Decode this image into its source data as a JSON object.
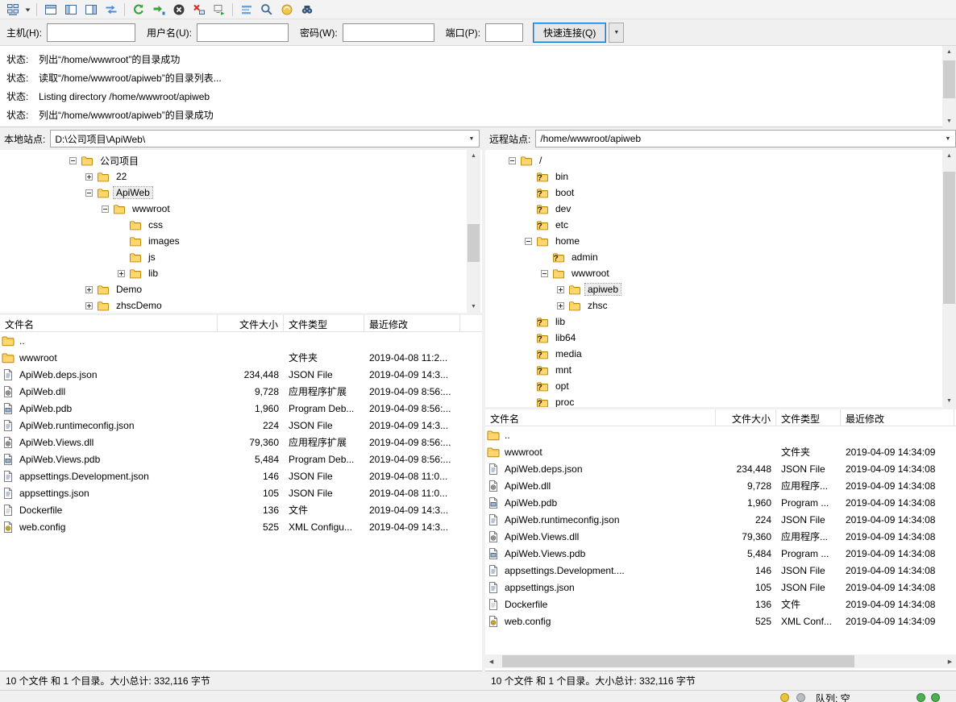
{
  "toolbar": {
    "items": [
      {
        "icon": "site-manager-icon"
      },
      {
        "icon": "site-manager-caret-icon",
        "narrow": true
      },
      {
        "separator": true
      },
      {
        "icon": "message-log-toggle-icon"
      },
      {
        "icon": "local-tree-toggle-icon"
      },
      {
        "icon": "remote-tree-toggle-icon"
      },
      {
        "icon": "queue-toggle-icon"
      },
      {
        "separator": true
      },
      {
        "icon": "refresh-icon"
      },
      {
        "icon": "process-queue-icon"
      },
      {
        "icon": "cancel-icon"
      },
      {
        "icon": "disconnect-icon"
      },
      {
        "icon": "reconnect-icon"
      },
      {
        "separator": true
      },
      {
        "icon": "filter-icon"
      },
      {
        "icon": "compare-icon"
      },
      {
        "icon": "sync-browse-icon"
      },
      {
        "icon": "find-icon"
      }
    ]
  },
  "quickconnect": {
    "host_label": "主机(H):",
    "host_value": "",
    "username_label": "用户名(U):",
    "username_value": "",
    "password_label": "密码(W):",
    "password_value": "",
    "port_label": "端口(P):",
    "port_value": "",
    "connect_label": "快速连接(Q)"
  },
  "log": {
    "lines": [
      {
        "prefix": "状态:",
        "text": "列出“/home/wwwroot”的目录成功"
      },
      {
        "prefix": "状态:",
        "text": "读取“/home/wwwroot/apiweb”的目录列表..."
      },
      {
        "prefix": "状态:",
        "text": "Listing directory /home/wwwroot/apiweb"
      },
      {
        "prefix": "状态:",
        "text": "列出“/home/wwwroot/apiweb”的目录成功"
      }
    ]
  },
  "local": {
    "site_label": "本地站点:",
    "site_path": "D:\\公司项目\\ApiWeb\\",
    "tree": [
      {
        "label": "公司项目",
        "level": 0,
        "expander": "minus",
        "icon": "folder"
      },
      {
        "label": "22",
        "level": 1,
        "expander": "plus",
        "icon": "folder"
      },
      {
        "label": "ApiWeb",
        "level": 1,
        "expander": "minus",
        "icon": "folder",
        "selected": true
      },
      {
        "label": "wwwroot",
        "level": 2,
        "expander": "minus",
        "icon": "folder"
      },
      {
        "label": "css",
        "level": 3,
        "expander": "none",
        "icon": "folder"
      },
      {
        "label": "images",
        "level": 3,
        "expander": "none",
        "icon": "folder"
      },
      {
        "label": "js",
        "level": 3,
        "expander": "none",
        "icon": "folder"
      },
      {
        "label": "lib",
        "level": 3,
        "expander": "plus",
        "icon": "folder"
      },
      {
        "label": "Demo",
        "level": 1,
        "expander": "plus",
        "icon": "folder"
      },
      {
        "label": "zhscDemo",
        "level": 1,
        "expander": "plus",
        "icon": "folder"
      }
    ],
    "columns": [
      {
        "label": "文件名"
      },
      {
        "label": "文件大小"
      },
      {
        "label": "文件类型"
      },
      {
        "label": "最近修改"
      }
    ],
    "files": [
      {
        "icon": "folder",
        "name": "..",
        "size": "",
        "type": "",
        "modified": ""
      },
      {
        "icon": "folder",
        "name": "wwwroot",
        "size": "",
        "type": "文件夹",
        "modified": "2019-04-08 11:2..."
      },
      {
        "icon": "file-json",
        "name": "ApiWeb.deps.json",
        "size": "234,448",
        "type": "JSON File",
        "modified": "2019-04-09 14:3..."
      },
      {
        "icon": "file-dll",
        "name": "ApiWeb.dll",
        "size": "9,728",
        "type": "应用程序扩展",
        "modified": "2019-04-09 8:56:..."
      },
      {
        "icon": "file-pdb",
        "name": "ApiWeb.pdb",
        "size": "1,960",
        "type": "Program Deb...",
        "modified": "2019-04-09 8:56:..."
      },
      {
        "icon": "file-json",
        "name": "ApiWeb.runtimeconfig.json",
        "size": "224",
        "type": "JSON File",
        "modified": "2019-04-09 14:3..."
      },
      {
        "icon": "file-dll",
        "name": "ApiWeb.Views.dll",
        "size": "79,360",
        "type": "应用程序扩展",
        "modified": "2019-04-09 8:56:..."
      },
      {
        "icon": "file-pdb",
        "name": "ApiWeb.Views.pdb",
        "size": "5,484",
        "type": "Program Deb...",
        "modified": "2019-04-09 8:56:..."
      },
      {
        "icon": "file-json",
        "name": "appsettings.Development.json",
        "size": "146",
        "type": "JSON File",
        "modified": "2019-04-08 11:0..."
      },
      {
        "icon": "file-json",
        "name": "appsettings.json",
        "size": "105",
        "type": "JSON File",
        "modified": "2019-04-08 11:0..."
      },
      {
        "icon": "file-generic",
        "name": "Dockerfile",
        "size": "136",
        "type": "文件",
        "modified": "2019-04-09 14:3..."
      },
      {
        "icon": "file-config",
        "name": "web.config",
        "size": "525",
        "type": "XML Configu...",
        "modified": "2019-04-09 14:3..."
      }
    ],
    "status": "10 个文件 和 1 个目录。大小总计: 332,116 字节"
  },
  "remote": {
    "site_label": "远程站点:",
    "site_path": "/home/wwwroot/apiweb",
    "tree": [
      {
        "label": "/",
        "level": 0,
        "expander": "minus",
        "icon": "folder"
      },
      {
        "label": "bin",
        "level": 1,
        "expander": "none",
        "icon": "folder-question"
      },
      {
        "label": "boot",
        "level": 1,
        "expander": "none",
        "icon": "folder-question"
      },
      {
        "label": "dev",
        "level": 1,
        "expander": "none",
        "icon": "folder-question"
      },
      {
        "label": "etc",
        "level": 1,
        "expander": "none",
        "icon": "folder-question"
      },
      {
        "label": "home",
        "level": 1,
        "expander": "minus",
        "icon": "folder"
      },
      {
        "label": "admin",
        "level": 2,
        "expander": "none",
        "icon": "folder-question"
      },
      {
        "label": "wwwroot",
        "level": 2,
        "expander": "minus",
        "icon": "folder"
      },
      {
        "label": "apiweb",
        "level": 3,
        "expander": "plus",
        "icon": "folder",
        "selected": true
      },
      {
        "label": "zhsc",
        "level": 3,
        "expander": "plus",
        "icon": "folder"
      },
      {
        "label": "lib",
        "level": 1,
        "expander": "none",
        "icon": "folder-question"
      },
      {
        "label": "lib64",
        "level": 1,
        "expander": "none",
        "icon": "folder-question"
      },
      {
        "label": "media",
        "level": 1,
        "expander": "none",
        "icon": "folder-question"
      },
      {
        "label": "mnt",
        "level": 1,
        "expander": "none",
        "icon": "folder-question"
      },
      {
        "label": "opt",
        "level": 1,
        "expander": "none",
        "icon": "folder-question"
      },
      {
        "label": "proc",
        "level": 1,
        "expander": "none",
        "icon": "folder-question"
      }
    ],
    "columns": [
      {
        "label": "文件名"
      },
      {
        "label": "文件大小"
      },
      {
        "label": "文件类型"
      },
      {
        "label": "最近修改"
      }
    ],
    "files": [
      {
        "icon": "folder",
        "name": "..",
        "size": "",
        "type": "",
        "modified": ""
      },
      {
        "icon": "folder",
        "name": "wwwroot",
        "size": "",
        "type": "文件夹",
        "modified": "2019-04-09 14:34:09"
      },
      {
        "icon": "file-json",
        "name": "ApiWeb.deps.json",
        "size": "234,448",
        "type": "JSON File",
        "modified": "2019-04-09 14:34:08"
      },
      {
        "icon": "file-dll",
        "name": "ApiWeb.dll",
        "size": "9,728",
        "type": "应用程序...",
        "modified": "2019-04-09 14:34:08"
      },
      {
        "icon": "file-pdb",
        "name": "ApiWeb.pdb",
        "size": "1,960",
        "type": "Program ...",
        "modified": "2019-04-09 14:34:08"
      },
      {
        "icon": "file-json",
        "name": "ApiWeb.runtimeconfig.json",
        "size": "224",
        "type": "JSON File",
        "modified": "2019-04-09 14:34:08"
      },
      {
        "icon": "file-dll",
        "name": "ApiWeb.Views.dll",
        "size": "79,360",
        "type": "应用程序...",
        "modified": "2019-04-09 14:34:08"
      },
      {
        "icon": "file-pdb",
        "name": "ApiWeb.Views.pdb",
        "size": "5,484",
        "type": "Program ...",
        "modified": "2019-04-09 14:34:08"
      },
      {
        "icon": "file-json",
        "name": "appsettings.Development....",
        "size": "146",
        "type": "JSON File",
        "modified": "2019-04-09 14:34:08"
      },
      {
        "icon": "file-json",
        "name": "appsettings.json",
        "size": "105",
        "type": "JSON File",
        "modified": "2019-04-09 14:34:08"
      },
      {
        "icon": "file-generic",
        "name": "Dockerfile",
        "size": "136",
        "type": "文件",
        "modified": "2019-04-09 14:34:08"
      },
      {
        "icon": "file-config",
        "name": "web.config",
        "size": "525",
        "type": "XML Conf...",
        "modified": "2019-04-09 14:34:09"
      }
    ],
    "status": "10 个文件 和 1 个目录。大小总计: 332,116 字节"
  },
  "queue": {
    "label": "队列: 空"
  }
}
